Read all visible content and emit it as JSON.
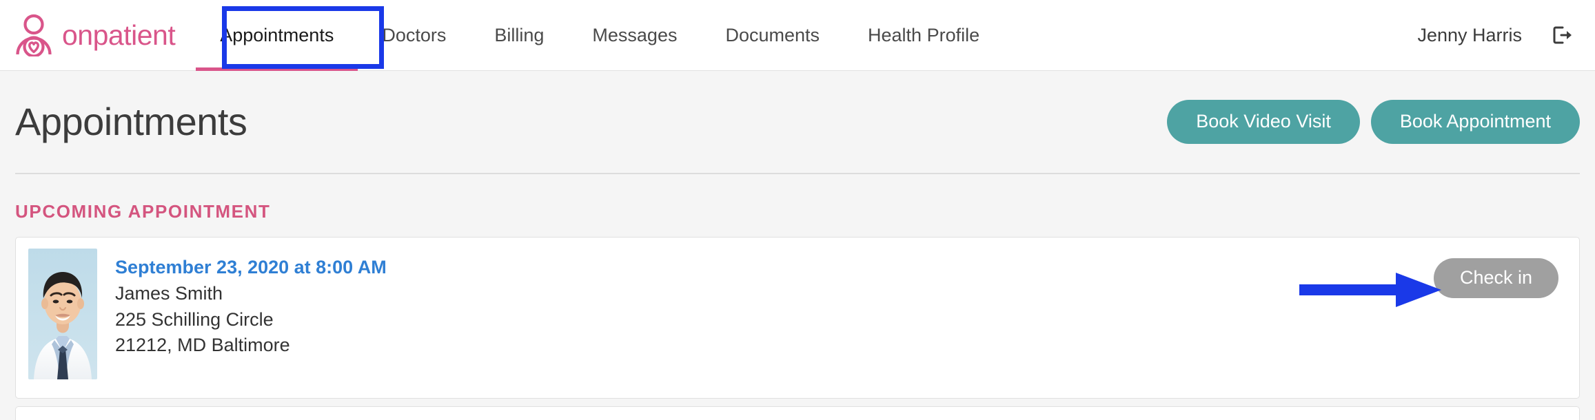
{
  "header": {
    "brand": {
      "name": "onpatient",
      "logo_icon": "onpatient-person-heart-logo",
      "color": "#d9558a"
    },
    "nav": [
      {
        "label": "Appointments",
        "active": true
      },
      {
        "label": "Doctors",
        "active": false
      },
      {
        "label": "Billing",
        "active": false
      },
      {
        "label": "Messages",
        "active": false
      },
      {
        "label": "Documents",
        "active": false
      },
      {
        "label": "Health Profile",
        "active": false
      }
    ],
    "user": {
      "name": "Jenny Harris",
      "logout_icon": "logout-icon"
    }
  },
  "page": {
    "title": "Appointments",
    "actions": [
      {
        "label": "Book Video Visit",
        "color": "#4ea3a3"
      },
      {
        "label": "Book Appointment",
        "color": "#4ea3a3"
      }
    ],
    "section_label": "UPCOMING APPOINTMENT",
    "appointment": {
      "avatar_icon": "doctor-portrait-photo",
      "datetime": "September 23, 2020 at 8:00 AM",
      "doctor": "James Smith",
      "address_line1": "225 Schilling Circle",
      "address_line2": "21212, MD Baltimore",
      "checkin_label": "Check in",
      "checkin_color": "#a0a0a0",
      "datetime_color": "#2f7fd4"
    }
  },
  "annotations": {
    "highlight_color": "#1a39e8",
    "highlight_target": "Appointments",
    "arrow_target": "Check in"
  }
}
